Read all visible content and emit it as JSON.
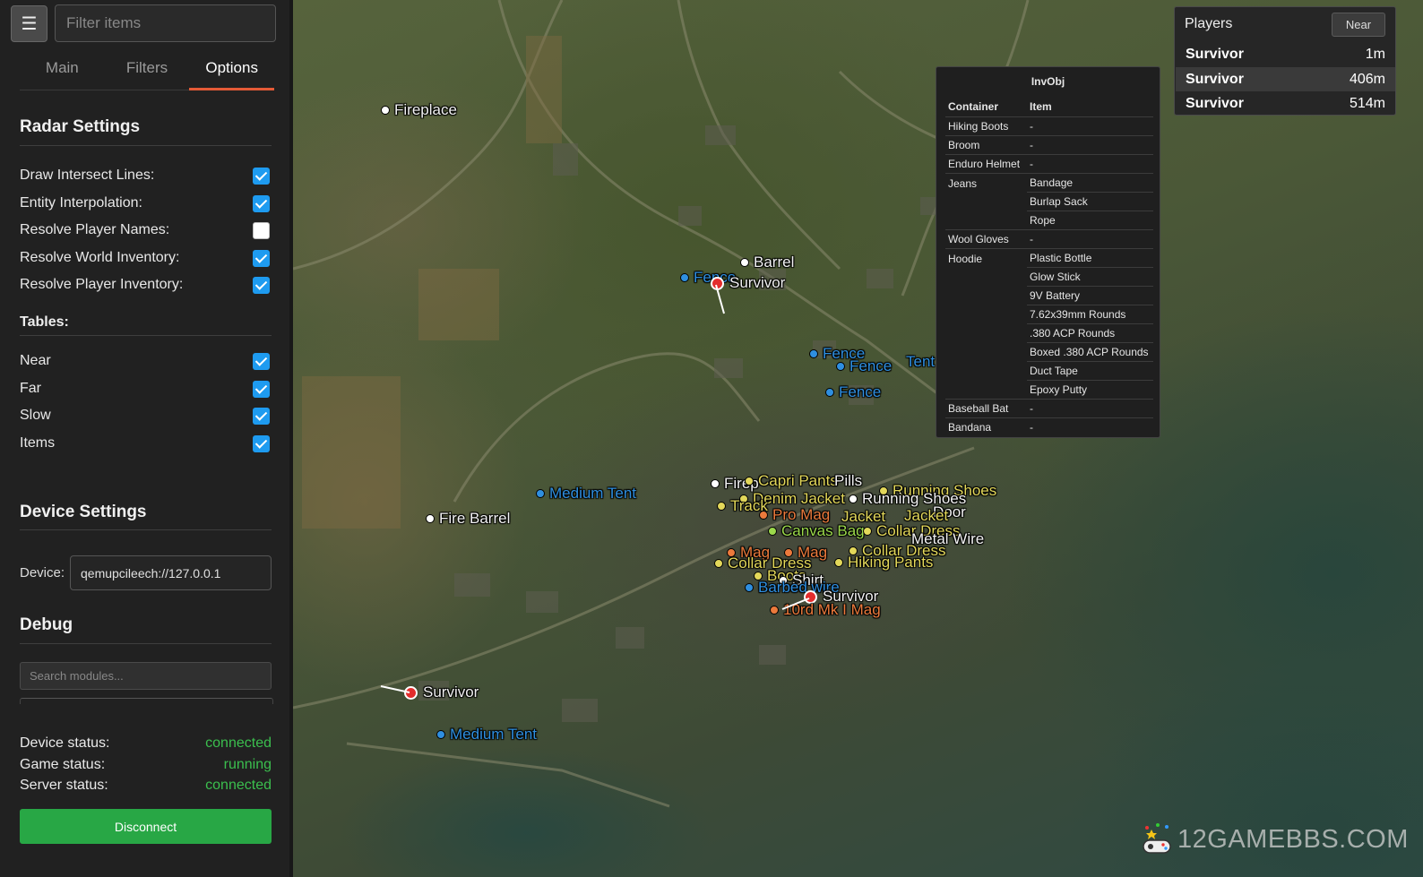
{
  "header": {
    "menu_icon": "hamburger-icon",
    "filter_placeholder": "Filter items"
  },
  "tabs": [
    {
      "label": "Main",
      "active": false
    },
    {
      "label": "Filters",
      "active": false
    },
    {
      "label": "Options",
      "active": true
    }
  ],
  "radar": {
    "title": "Radar Settings",
    "options": [
      {
        "label": "Draw Intersect Lines:",
        "checked": true
      },
      {
        "label": "Entity Interpolation:",
        "checked": true
      },
      {
        "label": "Resolve Player Names:",
        "checked": false
      },
      {
        "label": "Resolve World Inventory:",
        "checked": true
      },
      {
        "label": "Resolve Player Inventory:",
        "checked": true
      }
    ],
    "tables_title": "Tables:",
    "tables": [
      {
        "label": "Near",
        "checked": true
      },
      {
        "label": "Far",
        "checked": true
      },
      {
        "label": "Slow",
        "checked": true
      },
      {
        "label": "Items",
        "checked": true
      }
    ]
  },
  "device": {
    "title": "Device Settings",
    "label": "Device:",
    "value": "qemupcileech://127.0.0.1"
  },
  "debug": {
    "title": "Debug",
    "search_placeholder": "Search modules..."
  },
  "status": [
    {
      "label": "Device status:",
      "value": "connected"
    },
    {
      "label": "Game status:",
      "value": "running"
    },
    {
      "label": "Server status:",
      "value": "connected"
    }
  ],
  "disconnect_label": "Disconnect",
  "colors": {
    "accent": "#e45a37",
    "checkbox": "#1e9bf0",
    "status_ok": "#3bbf4e",
    "button": "#28a745"
  },
  "invobj": {
    "title": "InvObj",
    "headers": [
      "Container",
      "Item"
    ],
    "rows": [
      {
        "container": "Hiking Boots",
        "items": [
          "-"
        ]
      },
      {
        "container": "Broom",
        "items": [
          "-"
        ]
      },
      {
        "container": "Enduro Helmet",
        "items": [
          "-"
        ]
      },
      {
        "container": "Jeans",
        "items": [
          "Bandage",
          "Burlap Sack",
          "Rope"
        ]
      },
      {
        "container": "Wool Gloves",
        "items": [
          "-"
        ]
      },
      {
        "container": "Hoodie",
        "items": [
          "Plastic Bottle",
          "Glow Stick",
          "9V Battery",
          "7.62x39mm Rounds",
          ".380 ACP Rounds",
          "Boxed .380 ACP Rounds",
          "Duct Tape",
          "Epoxy Putty"
        ]
      },
      {
        "container": "Baseball Bat",
        "items": [
          "-"
        ]
      },
      {
        "container": "Bandana",
        "items": [
          "-"
        ]
      }
    ]
  },
  "players_panel": {
    "title": "Players",
    "button": "Near",
    "rows": [
      {
        "name": "Survivor",
        "dist": "1m"
      },
      {
        "name": "Survivor",
        "dist": "406m"
      },
      {
        "name": "Survivor",
        "dist": "514m"
      }
    ]
  },
  "map_labels": {
    "fireplace": "Fireplace",
    "barrel": "Barrel",
    "fence": "Fence",
    "fire_barrel": "Fire Barrel",
    "medium_tent": "Medium Tent",
    "survivor": "Survivor",
    "capri_pants": "Capri Pants",
    "pills": "Pills",
    "fireplace_short": "Firep",
    "running_shoes": "Running Shoes",
    "denim_jacket": "Denim Jacket",
    "track": "Track",
    "jacket": "Jacket",
    "door": "Door",
    "canvas_bag": "Canvas Bag",
    "collar_dress": "Collar Dress",
    "metal_wire": "Metal Wire",
    "hiking_pants": "Hiking Pants",
    "boots": "Boots",
    "shirt": "Shirt",
    "barbed_wire": "Barbed wire",
    "mag": "Mag",
    "mag_10rd": "10rd Mk I Mag",
    "pro_mag": "Pro Mag",
    "tent_fragment": "Tent"
  },
  "watermark": "12GAMEBBS.COM"
}
